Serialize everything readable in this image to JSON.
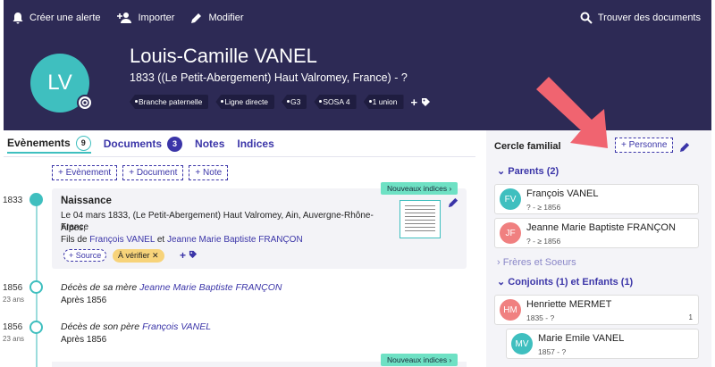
{
  "topbar": {
    "create_alert": "Créer une alerte",
    "import": "Importer",
    "edit": "Modifier",
    "find_docs": "Trouver des documents"
  },
  "person": {
    "initials": "LV",
    "name": "Louis-Camille VANEL",
    "subtitle": "1833 ((Le Petit-Abergement) Haut Valromey, France) - ?",
    "tags": [
      "Branche paternelle",
      "Ligne directe",
      "G3",
      "SOSA 4",
      "1 union"
    ],
    "tag_add": "+"
  },
  "tabs": [
    {
      "label": "Evènements",
      "count": "9"
    },
    {
      "label": "Documents",
      "count": "3"
    },
    {
      "label": "Notes"
    },
    {
      "label": "Indices"
    }
  ],
  "add_buttons": [
    "+ Evènement",
    "+ Document",
    "+ Note"
  ],
  "events": [
    {
      "year": "1833",
      "nouv": "Nouveaux indices ›",
      "title": "Naissance",
      "line1": "Le 04 mars 1833, (Le Petit-Abergement) Haut Valromey, Ain, Auvergne-Rhône-Alpes,",
      "line2": "France",
      "parents_prefix": "Fils de",
      "father": "François VANEL",
      "and": "et",
      "mother": "Jeanne Marie Baptiste FRANÇON",
      "source_btn": "+ Source",
      "verify": "À vérifier ✕",
      "plus": "+"
    },
    {
      "year": "1856",
      "age": "23 ans",
      "text": "Décès de sa mère",
      "link": "Jeanne Marie Baptiste FRANÇON",
      "sub": "Après 1856"
    },
    {
      "year": "1856",
      "age": "23 ans",
      "text": "Décès de son père",
      "link": "François VANEL",
      "sub": "Après 1856"
    }
  ],
  "nouv_bottom": "Nouveaux indices ›",
  "family": {
    "title": "Cercle familial",
    "add_person": "+ Personne",
    "parents_header": "Parents (2)",
    "siblings_header": "Frères et Soeurs",
    "spouses_header": "Conjoints (1) et Enfants (1)",
    "people": [
      {
        "initials": "FV",
        "name": "François VANEL",
        "dates": "? - ≥ 1856",
        "color": "#3fbfbf"
      },
      {
        "initials": "JF",
        "name": "Jeanne Marie Baptiste FRANÇON",
        "dates": "? - ≥ 1856",
        "color": "#f08080"
      },
      {
        "initials": "HM",
        "name": "Henriette MERMET",
        "dates": "1835 - ?",
        "count": "1",
        "color": "#f08080"
      },
      {
        "initials": "MV",
        "name": "Marie Emile VANEL",
        "dates": "1857 - ?",
        "color": "#3fbfbf"
      }
    ]
  },
  "colors": {
    "header": "#2d2a55",
    "accent": "#3fbfbf",
    "link": "#3b35a8",
    "arrow": "#f06470"
  }
}
